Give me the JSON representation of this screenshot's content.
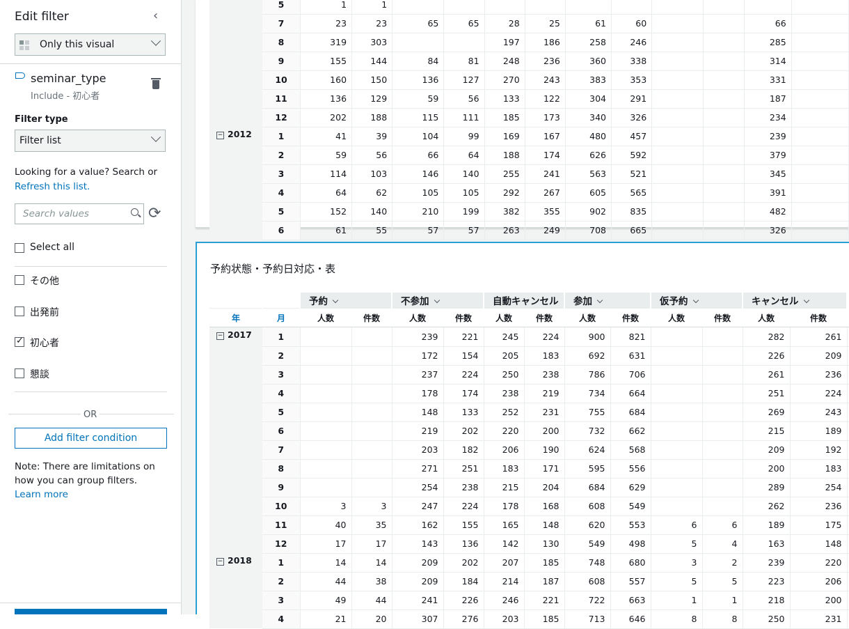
{
  "sidebar": {
    "title": "Edit filter",
    "scope_label": "Only this visual",
    "field_name": "seminar_type",
    "field_summary": "Include - 初心者",
    "filter_type_label": "Filter type",
    "filter_type_value": "Filter list",
    "search_hint": "Looking for a value? Search or",
    "refresh_link": "Refresh this list.",
    "search_placeholder": "Search values",
    "select_all_label": "Select all",
    "options": [
      {
        "label": "その他",
        "checked": false
      },
      {
        "label": "出発前",
        "checked": false
      },
      {
        "label": "初心者",
        "checked": true
      },
      {
        "label": "懇談",
        "checked": false
      }
    ],
    "or_label": "OR",
    "add_condition_label": "Add filter condition",
    "note_text": "Note: There are limitations on how you can group filters.",
    "learn_more": "Learn more"
  },
  "visual1": {
    "rows": [
      {
        "year": "",
        "month": "5",
        "cells": [
          "1",
          "1",
          "",
          "",
          "",
          "",
          "",
          "",
          "",
          "",
          "",
          ""
        ]
      },
      {
        "year": "",
        "month": "7",
        "cells": [
          "23",
          "23",
          "65",
          "65",
          "28",
          "25",
          "61",
          "60",
          "",
          "",
          "66",
          ""
        ]
      },
      {
        "year": "",
        "month": "8",
        "cells": [
          "319",
          "303",
          "",
          "",
          "197",
          "186",
          "258",
          "246",
          "",
          "",
          "285",
          ""
        ]
      },
      {
        "year": "",
        "month": "9",
        "cells": [
          "155",
          "144",
          "84",
          "81",
          "248",
          "236",
          "360",
          "338",
          "",
          "",
          "314",
          ""
        ]
      },
      {
        "year": "",
        "month": "10",
        "cells": [
          "160",
          "150",
          "136",
          "127",
          "270",
          "243",
          "383",
          "353",
          "",
          "",
          "331",
          ""
        ]
      },
      {
        "year": "",
        "month": "11",
        "cells": [
          "136",
          "129",
          "59",
          "56",
          "133",
          "122",
          "304",
          "291",
          "",
          "",
          "187",
          ""
        ]
      },
      {
        "year": "",
        "month": "12",
        "cells": [
          "202",
          "188",
          "115",
          "111",
          "185",
          "173",
          "340",
          "326",
          "",
          "",
          "234",
          ""
        ]
      },
      {
        "year": "2012",
        "month": "1",
        "cells": [
          "41",
          "39",
          "104",
          "99",
          "169",
          "167",
          "480",
          "457",
          "",
          "",
          "239",
          ""
        ]
      },
      {
        "year": "",
        "month": "2",
        "cells": [
          "59",
          "56",
          "66",
          "64",
          "188",
          "174",
          "626",
          "592",
          "",
          "",
          "379",
          ""
        ]
      },
      {
        "year": "",
        "month": "3",
        "cells": [
          "114",
          "103",
          "146",
          "140",
          "255",
          "241",
          "563",
          "521",
          "",
          "",
          "345",
          ""
        ]
      },
      {
        "year": "",
        "month": "4",
        "cells": [
          "64",
          "62",
          "105",
          "105",
          "292",
          "267",
          "605",
          "565",
          "",
          "",
          "391",
          ""
        ]
      },
      {
        "year": "",
        "month": "5",
        "cells": [
          "152",
          "140",
          "210",
          "199",
          "382",
          "355",
          "902",
          "835",
          "",
          "",
          "482",
          ""
        ]
      },
      {
        "year": "",
        "month": "6",
        "cells": [
          "61",
          "55",
          "57",
          "57",
          "263",
          "249",
          "708",
          "665",
          "",
          "",
          "326",
          ""
        ]
      }
    ]
  },
  "visual2": {
    "title": "予約状態・予約日対応・表",
    "groups": [
      "予約",
      "不参加",
      "自動キャンセル",
      "参加",
      "仮予約",
      "キャンセル"
    ],
    "year_header": "年",
    "month_header": "月",
    "sub_headers": [
      "人数",
      "件数",
      "人数",
      "件数",
      "人数",
      "件数",
      "人数",
      "件数",
      "人数",
      "件数",
      "人数",
      "件数"
    ],
    "rows": [
      {
        "year": "2017",
        "month": "1",
        "cells": [
          "",
          "",
          "239",
          "221",
          "245",
          "224",
          "900",
          "821",
          "",
          "",
          "282",
          "261"
        ]
      },
      {
        "year": "",
        "month": "2",
        "cells": [
          "",
          "",
          "172",
          "154",
          "205",
          "183",
          "692",
          "631",
          "",
          "",
          "226",
          "209"
        ]
      },
      {
        "year": "",
        "month": "3",
        "cells": [
          "",
          "",
          "237",
          "224",
          "250",
          "238",
          "786",
          "706",
          "",
          "",
          "261",
          "236"
        ]
      },
      {
        "year": "",
        "month": "4",
        "cells": [
          "",
          "",
          "178",
          "174",
          "238",
          "219",
          "734",
          "664",
          "",
          "",
          "251",
          "224"
        ]
      },
      {
        "year": "",
        "month": "5",
        "cells": [
          "",
          "",
          "148",
          "133",
          "252",
          "231",
          "755",
          "684",
          "",
          "",
          "269",
          "243"
        ]
      },
      {
        "year": "",
        "month": "6",
        "cells": [
          "",
          "",
          "219",
          "202",
          "220",
          "200",
          "732",
          "662",
          "",
          "",
          "215",
          "189"
        ]
      },
      {
        "year": "",
        "month": "7",
        "cells": [
          "",
          "",
          "203",
          "182",
          "206",
          "190",
          "624",
          "568",
          "",
          "",
          "209",
          "192"
        ]
      },
      {
        "year": "",
        "month": "8",
        "cells": [
          "",
          "",
          "271",
          "251",
          "183",
          "171",
          "595",
          "556",
          "",
          "",
          "200",
          "183"
        ]
      },
      {
        "year": "",
        "month": "9",
        "cells": [
          "",
          "",
          "254",
          "238",
          "215",
          "204",
          "684",
          "629",
          "",
          "",
          "289",
          "254"
        ]
      },
      {
        "year": "",
        "month": "10",
        "cells": [
          "3",
          "3",
          "247",
          "224",
          "178",
          "168",
          "608",
          "549",
          "",
          "",
          "262",
          "236"
        ]
      },
      {
        "year": "",
        "month": "11",
        "cells": [
          "40",
          "35",
          "162",
          "155",
          "165",
          "148",
          "620",
          "553",
          "6",
          "6",
          "189",
          "175"
        ]
      },
      {
        "year": "",
        "month": "12",
        "cells": [
          "17",
          "17",
          "143",
          "136",
          "142",
          "130",
          "549",
          "498",
          "5",
          "4",
          "163",
          "148"
        ]
      },
      {
        "year": "2018",
        "month": "1",
        "cells": [
          "14",
          "14",
          "209",
          "202",
          "207",
          "185",
          "748",
          "680",
          "3",
          "2",
          "239",
          "220"
        ]
      },
      {
        "year": "",
        "month": "2",
        "cells": [
          "44",
          "38",
          "209",
          "184",
          "214",
          "187",
          "608",
          "557",
          "5",
          "5",
          "223",
          "206"
        ]
      },
      {
        "year": "",
        "month": "3",
        "cells": [
          "49",
          "44",
          "241",
          "226",
          "246",
          "221",
          "722",
          "663",
          "1",
          "1",
          "218",
          "200"
        ]
      },
      {
        "year": "",
        "month": "4",
        "cells": [
          "21",
          "20",
          "307",
          "276",
          "203",
          "185",
          "713",
          "646",
          "8",
          "8",
          "250",
          "231"
        ]
      }
    ]
  }
}
